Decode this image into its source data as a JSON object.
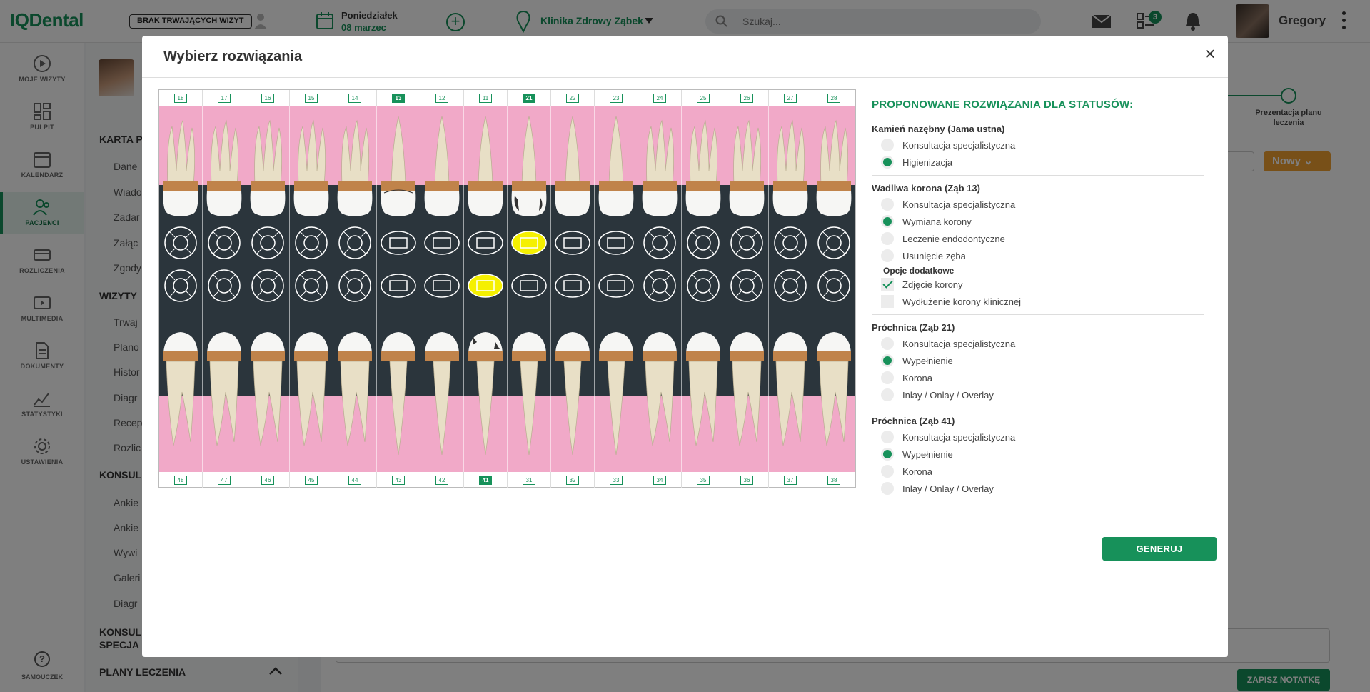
{
  "app": {
    "logo": "IQDental"
  },
  "topbar": {
    "no_visit": "BRAK TRWAJĄCYCH WIZYT",
    "day": "Poniedziałek",
    "date": "08 marzec",
    "clinic": "Klinika Zdrowy Ząbek",
    "search_placeholder": "Szukaj...",
    "tasks_count": "3",
    "user": "Gregory"
  },
  "nav": {
    "items": [
      {
        "label": "MOJE WIZYTY",
        "icon": "play-circle-icon"
      },
      {
        "label": "PULPIT",
        "icon": "dashboard-icon"
      },
      {
        "label": "KALENDARZ",
        "icon": "calendar-icon"
      },
      {
        "label": "PACJENCI",
        "icon": "patients-icon"
      },
      {
        "label": "ROZLICZENIA",
        "icon": "card-icon"
      },
      {
        "label": "MULTIMEDIA",
        "icon": "media-icon"
      },
      {
        "label": "DOKUMENTY",
        "icon": "document-icon"
      },
      {
        "label": "STATYSTYKI",
        "icon": "stats-icon"
      },
      {
        "label": "USTAWIENIA",
        "icon": "gear-icon"
      }
    ],
    "help": "SAMOUCZEK"
  },
  "patient": {
    "sections": [
      {
        "title": "KARTA P",
        "items": [
          "Dane",
          "Wiado",
          "Zadar",
          "Załąc",
          "Zgody"
        ]
      },
      {
        "title": "WIZYTY",
        "items": [
          "Trwaj",
          "Plano",
          "Histor",
          "Diagr",
          "Recep",
          "Rozlic"
        ]
      },
      {
        "title": "KONSUL",
        "items": [
          "Ankie",
          "Ankie",
          "Wywi",
          "Galeri",
          "Diagr"
        ]
      }
    ],
    "section4": [
      "KONSUL",
      "SPECJA"
    ],
    "plans": "PLANY LECZENIA"
  },
  "background": {
    "step_label": "Prezentacja planu leczenia",
    "new_button": "Nowy",
    "note_button": "ZAPISZ NOTATKĘ"
  },
  "modal": {
    "title": "Wybierz rozwiązania",
    "close": "×",
    "upper_numbers": [
      "18",
      "17",
      "16",
      "15",
      "14",
      "13",
      "12",
      "11",
      "21",
      "22",
      "23",
      "24",
      "25",
      "26",
      "27",
      "28"
    ],
    "lower_numbers": [
      "48",
      "47",
      "46",
      "45",
      "44",
      "43",
      "42",
      "41",
      "31",
      "32",
      "33",
      "34",
      "35",
      "36",
      "37",
      "38"
    ],
    "selected_teeth": [
      "13",
      "21",
      "41"
    ],
    "options_title": "PROPONOWANE ROZWIĄZANIA DLA STATUSÓW:",
    "groups": [
      {
        "name": "Kamień nazębny (Jama ustna)",
        "options": [
          {
            "label": "Konsultacja specjalistyczna",
            "selected": false
          },
          {
            "label": "Higienizacja",
            "selected": true
          }
        ]
      },
      {
        "name": "Wadliwa korona (Ząb 13)",
        "options": [
          {
            "label": "Konsultacja specjalistyczna",
            "selected": false
          },
          {
            "label": "Wymiana korony",
            "selected": true
          },
          {
            "label": "Leczenie endodontyczne",
            "selected": false
          },
          {
            "label": "Usunięcie zęba",
            "selected": false
          }
        ],
        "extra_title": "Opcje dodatkowe",
        "extras": [
          {
            "label": "Zdjęcie korony",
            "checked": true
          },
          {
            "label": "Wydłużenie korony klinicznej",
            "checked": false
          }
        ]
      },
      {
        "name": "Próchnica (Ząb 21)",
        "options": [
          {
            "label": "Konsultacja specjalistyczna",
            "selected": false
          },
          {
            "label": "Wypełnienie",
            "selected": true
          },
          {
            "label": "Korona",
            "selected": false
          },
          {
            "label": "Inlay / Onlay / Overlay",
            "selected": false
          }
        ]
      },
      {
        "name": "Próchnica (Ząb 41)",
        "options": [
          {
            "label": "Konsultacja specjalistyczna",
            "selected": false
          },
          {
            "label": "Wypełnienie",
            "selected": true
          },
          {
            "label": "Korona",
            "selected": false
          },
          {
            "label": "Inlay / Onlay / Overlay",
            "selected": false
          }
        ]
      }
    ],
    "generate": "GENERUJ"
  },
  "colors": {
    "brand": "#17915a",
    "gum": "#f1a9c8",
    "dark": "#2b353c",
    "caries": "#f5f000",
    "accent": "#f0a030"
  }
}
